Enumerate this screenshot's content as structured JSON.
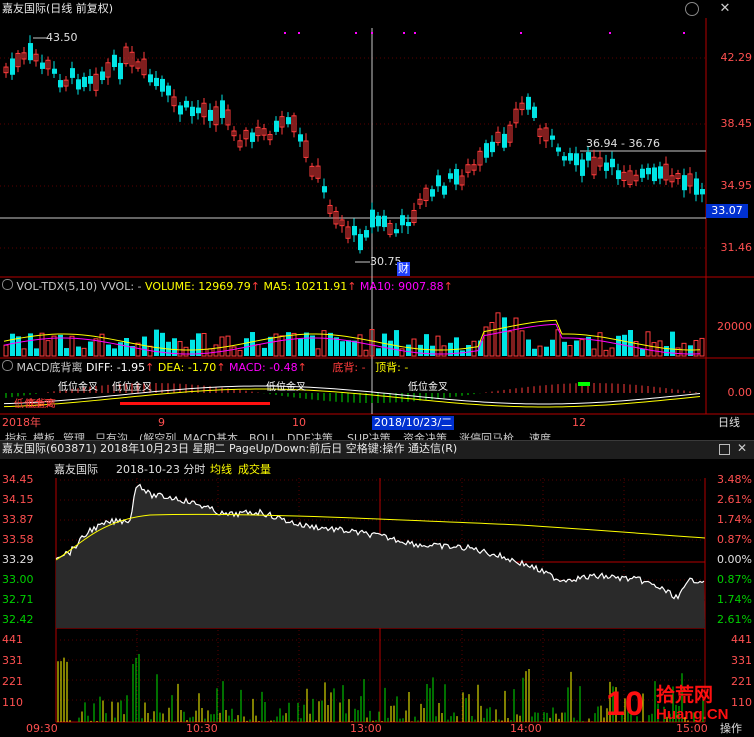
{
  "top_chart": {
    "title": "嘉友国际(日线 前复权)",
    "hi_label": "43.50",
    "lo_label": "30.75",
    "range_label": "36.94 - 36.76",
    "cai_label": "财",
    "price_ticks": [
      "42.29",
      "38.45",
      "34.95",
      "31.46"
    ],
    "cursor_price": "33.07",
    "date_ticks": [
      "2018年",
      "9",
      "10",
      "12"
    ],
    "cursor_date": "2018/10/23/二",
    "right_label": "日线"
  },
  "volume_panel": {
    "name": "VOL-TDX(5,10)",
    "vvol": "VVOL: -",
    "volume": "VOLUME: 12969.79",
    "ma5": "MA5: 10211.91",
    "ma10": "MA10: 9007.88",
    "tick": "20000"
  },
  "macd_panel": {
    "name": "MACD底背离",
    "diff": "DIFF: -1.95",
    "dea": "DEA: -1.70",
    "macd": "MACD: -0.48",
    "dibei": "底背:",
    "dingbei": "顶背:",
    "dash": "-",
    "tick": "0.00",
    "annot1": "低位金叉",
    "annot2": "低位金叉",
    "annot3": "低位金叉",
    "annot4": "低位金叉",
    "annot5": "低位金叉",
    "tag": "底背离"
  },
  "tabs": [
    "指标",
    "模板",
    "管理",
    "只有沟",
    "(解空列",
    "MACD基本",
    "BOLL",
    "DDE决策",
    "SUP决策",
    "资金决策",
    "涨停回马枪",
    "速度"
  ],
  "popup": {
    "title": "嘉友国际(603871) 2018年10月23日 星期二 PageUp/Down:前后日 空格键:操作 通达信(R)",
    "stock": "嘉友国际",
    "date": "2018-10-23 分时",
    "avg_label": "均线",
    "vol_label": "成交量",
    "price_left": [
      "34.45",
      "34.15",
      "33.87",
      "33.58",
      "33.29",
      "33.00",
      "32.71",
      "32.42"
    ],
    "pct_right": [
      "3.48%",
      "2.61%",
      "1.74%",
      "0.87%",
      "0.00%",
      "0.87%",
      "1.74%",
      "2.61%"
    ],
    "vol_left": [
      "441",
      "331",
      "221",
      "110"
    ],
    "vol_right": [
      "441",
      "331",
      "221",
      "110"
    ],
    "time_ticks": [
      "09:30",
      "10:30",
      "13:00",
      "14:00",
      "15:00"
    ],
    "operate_label": "操作",
    "logo_num": "10",
    "logo_cn": "拾荒网",
    "logo_url": "Huang.CN"
  },
  "colors": {
    "up": "#ff3c3c",
    "down": "#00e5e5",
    "panel_line": "#b40000",
    "yellow": "#ffff00",
    "magenta": "#ff00ff"
  }
}
